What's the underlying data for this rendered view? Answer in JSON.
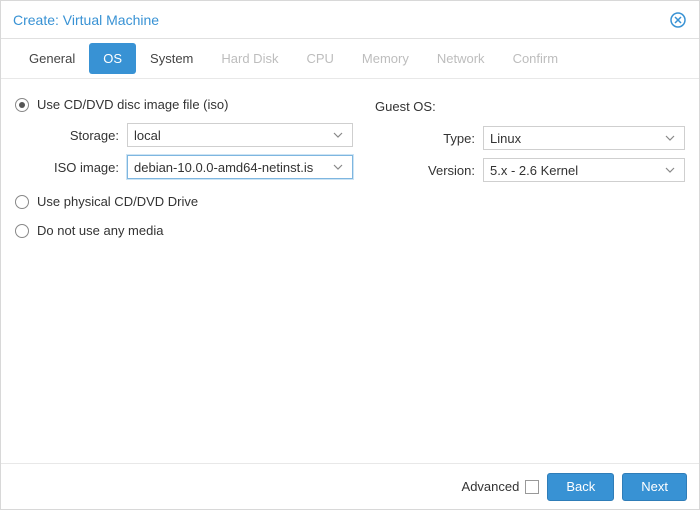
{
  "title": "Create: Virtual Machine",
  "tabs": {
    "general": "General",
    "os": "OS",
    "system": "System",
    "harddisk": "Hard Disk",
    "cpu": "CPU",
    "memory": "Memory",
    "network": "Network",
    "confirm": "Confirm"
  },
  "media": {
    "iso_radio": "Use CD/DVD disc image file (iso)",
    "physical_radio": "Use physical CD/DVD Drive",
    "none_radio": "Do not use any media",
    "storage_label": "Storage:",
    "storage_value": "local",
    "iso_label": "ISO image:",
    "iso_value_a": "debian-10.0.0-amd64-netinst.is"
  },
  "guest": {
    "heading": "Guest OS:",
    "type_label": "Type:",
    "type_value": "Linux",
    "version_label": "Version:",
    "version_value": "5.x - 2.6 Kernel"
  },
  "footer": {
    "advanced": "Advanced",
    "back": "Back",
    "next": "Next"
  }
}
